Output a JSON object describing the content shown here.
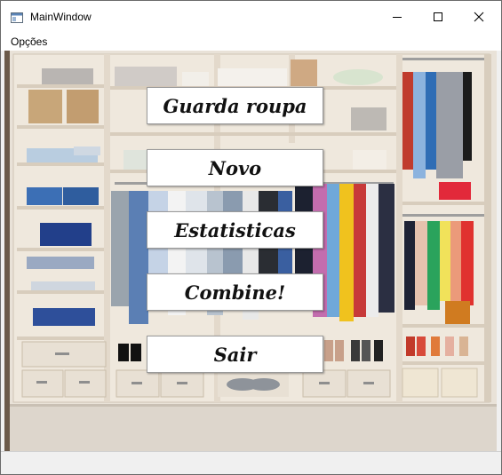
{
  "window": {
    "title": "MainWindow"
  },
  "menubar": {
    "items": [
      {
        "label": "Opções"
      }
    ]
  },
  "buttons": [
    {
      "label": "Guarda roupa"
    },
    {
      "label": "Novo"
    },
    {
      "label": "Estatisticas"
    },
    {
      "label": "Combine!"
    },
    {
      "label": "Sair"
    }
  ],
  "colors": {
    "accent": "#000000",
    "title_bar": "#ffffff",
    "button_bg": "#ffffff"
  },
  "icons": [
    "app-window-icon",
    "minimize-icon",
    "maximize-icon",
    "close-icon"
  ]
}
